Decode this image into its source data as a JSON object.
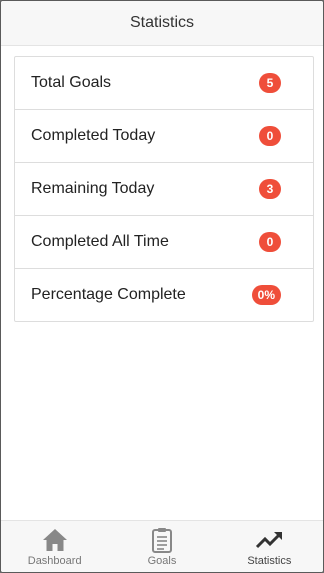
{
  "header": {
    "title": "Statistics"
  },
  "stats": [
    {
      "label": "Total Goals",
      "value": "5"
    },
    {
      "label": "Completed Today",
      "value": "0"
    },
    {
      "label": "Remaining Today",
      "value": "3"
    },
    {
      "label": "Completed All Time",
      "value": "0"
    },
    {
      "label": "Percentage Complete",
      "value": "0%"
    }
  ],
  "tabs": [
    {
      "label": "Dashboard",
      "icon": "home-icon"
    },
    {
      "label": "Goals",
      "icon": "clipboard-icon"
    },
    {
      "label": "Statistics",
      "icon": "trending-up-icon",
      "active": true
    }
  ],
  "colors": {
    "badge": "#ef4e3a",
    "bar_background": "#f7f7f7"
  }
}
